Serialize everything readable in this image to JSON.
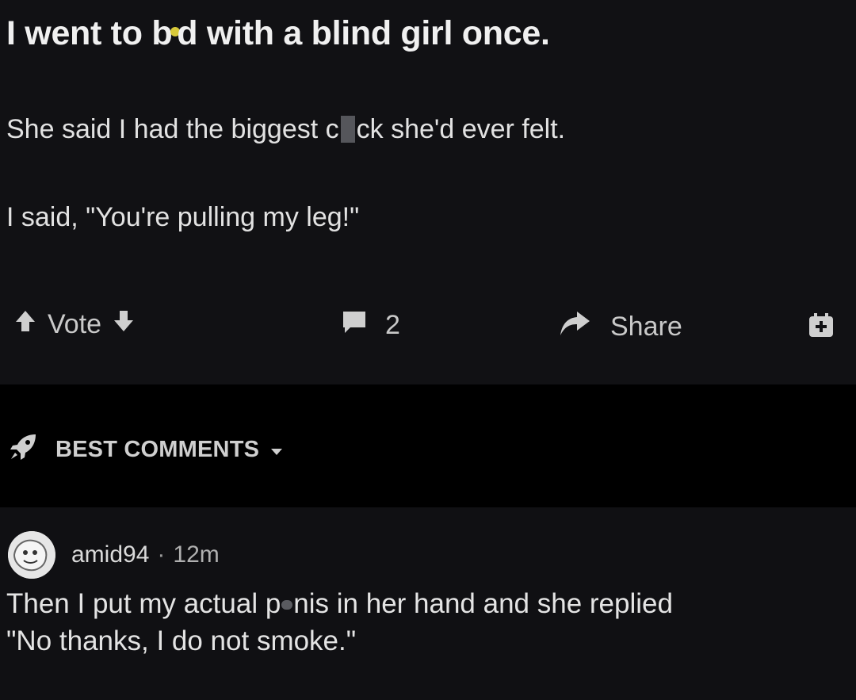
{
  "post": {
    "title_part1": "I went to b",
    "title_part2": "d with a blind girl once.",
    "line1_part1": "She said I had the biggest c",
    "line1_part2": "ck she'd ever felt.",
    "line2": "I said, \"You're pulling my leg!\""
  },
  "actions": {
    "vote_label": "Vote",
    "comment_count": "2",
    "share_label": "Share",
    "icons": [
      "upvote-icon",
      "downvote-icon",
      "comment-icon",
      "share-icon",
      "add-icon"
    ]
  },
  "comments_section": {
    "sort_label": "BEST COMMENTS",
    "icon": "rocket-icon"
  },
  "comment": {
    "username": "amid94",
    "separator": "·",
    "age": "12m",
    "body_part1": "Then I put my actual p",
    "body_part2": "nis in her hand and she replied",
    "body_line2": "\"No thanks, I do not smoke.\""
  },
  "colors": {
    "background": "#000000",
    "post_background": "#111114",
    "text": "#e6e6e6",
    "muted": "#c9c9c9",
    "censor": "#55565b"
  }
}
